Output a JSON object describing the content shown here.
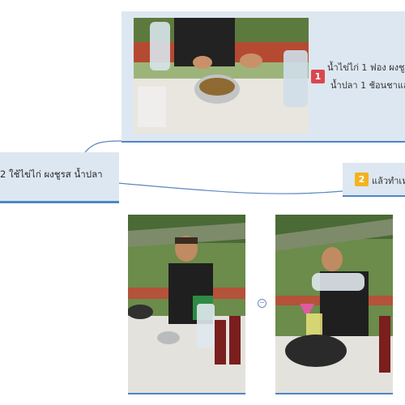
{
  "steps": {
    "step1": {
      "number": "1",
      "line1": "น้ำไข่ไก่ 1 ฟอง ผงชูร",
      "line2": "น้ำปลา 1 ช้อนชาแล้",
      "badge_color": "#d9474f"
    },
    "step2": {
      "number": "2",
      "label": "แล้วทำเห",
      "badge_color": "#f2b320"
    }
  },
  "left_node": {
    "label": "2 ใช้ไข่ไก่ ผงชูรส น้ำปลา"
  },
  "colors": {
    "node_fill": "#dde7f1",
    "node_border": "#4f86c6",
    "connector": "#5a86c2"
  },
  "icons": {
    "collapse": "collapse-toggle-icon"
  },
  "glyphs": {
    "collapse": "−"
  }
}
